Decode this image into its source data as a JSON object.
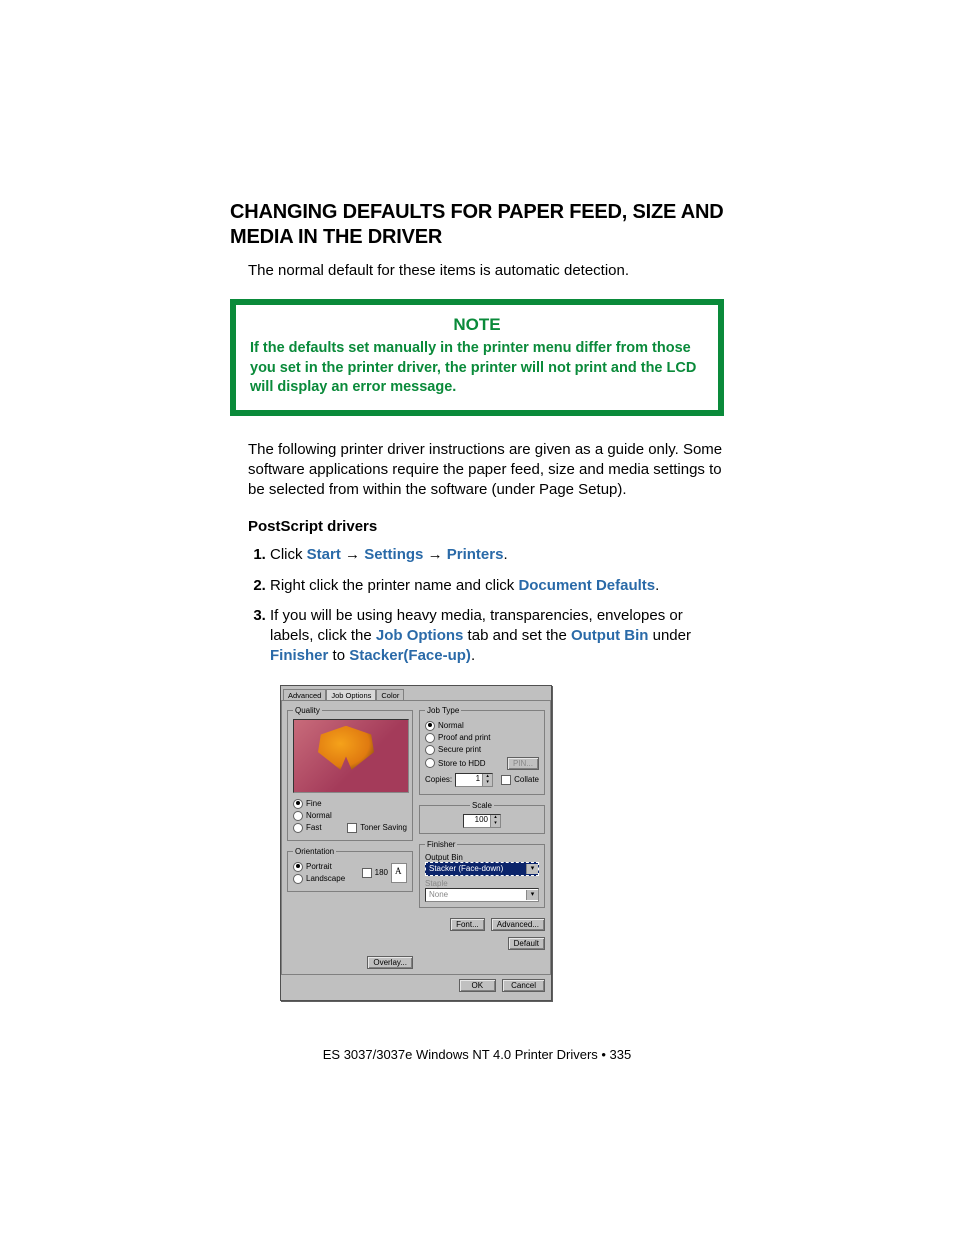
{
  "heading": "CHANGING DEFAULTS FOR PAPER FEED, SIZE AND MEDIA IN THE DRIVER",
  "intro": "The normal default for these items is automatic detection.",
  "note": {
    "title": "NOTE",
    "body": "If the defaults set manually in the printer menu differ from those you set in the printer driver, the printer will not print and the LCD will display an error message."
  },
  "para2": "The following printer driver instructions are given as a guide only. Some software applications require the paper feed, size and media settings to be selected from within the software (under Page Setup).",
  "subhead": "PostScript drivers",
  "steps": {
    "s1_pre": "Click ",
    "s1_t1": "Start",
    "s1_t2": "Settings",
    "s1_t3": "Printers",
    "s1_post": ".",
    "s2_pre": "Right click the printer name and click ",
    "s2_t1": "Document Defaults",
    "s2_post": ".",
    "s3_pre": "If you will be using heavy media, transparencies, envelopes or labels, click the ",
    "s3_t1": "Job Options",
    "s3_mid1": " tab and set the ",
    "s3_t2": "Output Bin",
    "s3_mid2": " under ",
    "s3_t3": "Finisher",
    "s3_mid3": " to ",
    "s3_t4": "Stacker(Face-up)",
    "s3_post": "."
  },
  "arrow": "→",
  "dialog": {
    "tabs": {
      "t1": "Advanced",
      "t2": "Job Options",
      "t3": "Color"
    },
    "quality": {
      "legend": "Quality",
      "fine": "Fine",
      "normal": "Normal",
      "fast": "Fast",
      "toner": "Toner Saving"
    },
    "orientation": {
      "legend": "Orientation",
      "portrait": "Portrait",
      "landscape": "Landscape",
      "r180": "180"
    },
    "overlay": "Overlay...",
    "jobtype": {
      "legend": "Job Type",
      "normal": "Normal",
      "proof": "Proof and print",
      "secure": "Secure print",
      "store": "Store to HDD",
      "pin": "PIN...",
      "copies_lbl": "Copies:",
      "copies_val": "1",
      "collate": "Collate"
    },
    "scale": {
      "legend": "Scale",
      "val": "100"
    },
    "finisher": {
      "legend": "Finisher",
      "outputbin_lbl": "Output Bin",
      "outputbin_val": "Stacker (Face-down)",
      "staple_lbl": "Staple",
      "staple_val": "None"
    },
    "font": "Font...",
    "advanced_btn": "Advanced...",
    "default": "Default",
    "ok": "OK",
    "cancel": "Cancel"
  },
  "footer": "ES 3037/3037e Windows NT 4.0 Printer Drivers • 335"
}
